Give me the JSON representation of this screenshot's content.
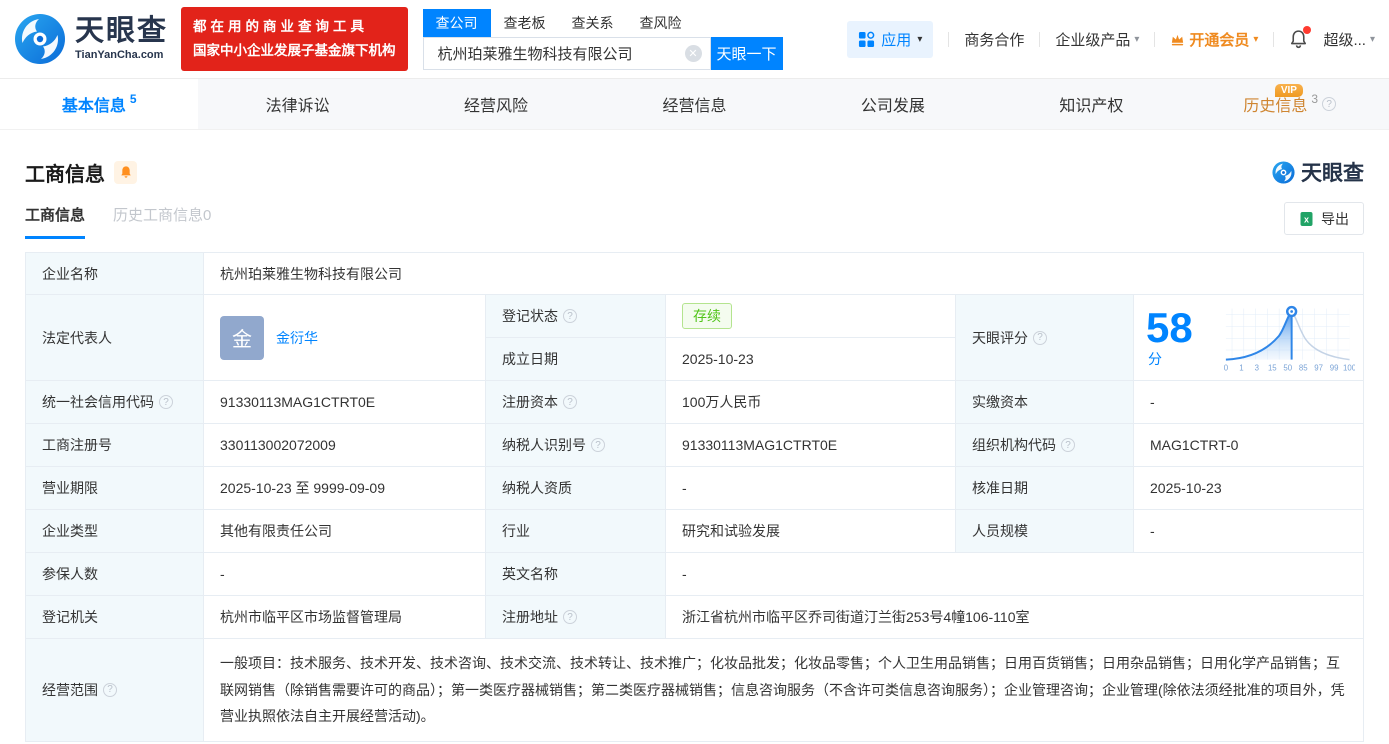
{
  "brand": {
    "name": "天眼查",
    "domain": "TianYanCha.com",
    "banner_line1": "都在用的商业查询工具",
    "banner_line2": "国家中小企业发展子基金旗下机构"
  },
  "search": {
    "tabs": [
      "查公司",
      "查老板",
      "查关系",
      "查风险"
    ],
    "value": "杭州珀莱雅生物科技有限公司",
    "button": "天眼一下"
  },
  "nav": {
    "apps": "应用",
    "biz_coop": "商务合作",
    "enterprise": "企业级产品",
    "vip": "开通会员",
    "super": "超级..."
  },
  "tabs": [
    {
      "label": "基本信息",
      "count": "5"
    },
    {
      "label": "法律诉讼",
      "count": ""
    },
    {
      "label": "经营风险",
      "count": ""
    },
    {
      "label": "经营信息",
      "count": ""
    },
    {
      "label": "公司发展",
      "count": ""
    },
    {
      "label": "知识产权",
      "count": ""
    },
    {
      "label": "历史信息",
      "count": "3",
      "badge": "VIP"
    }
  ],
  "section": {
    "title": "工商信息",
    "watermark": "天眼查",
    "subtab_active": "工商信息",
    "subtab_history": "历史工商信息0",
    "export": "导出"
  },
  "fields": {
    "company_name": {
      "label": "企业名称",
      "value": "杭州珀莱雅生物科技有限公司"
    },
    "legal_rep": {
      "label": "法定代表人",
      "avatar": "金",
      "name": "金衍华"
    },
    "reg_status": {
      "label": "登记状态",
      "value": "存续"
    },
    "establish_date": {
      "label": "成立日期",
      "value": "2025-10-23"
    },
    "score": {
      "label": "天眼评分",
      "value": "58",
      "unit": "分",
      "axis": [
        "0",
        "1",
        "3",
        "15",
        "50",
        "85",
        "97",
        "99",
        "100"
      ]
    },
    "credit_code": {
      "label": "统一社会信用代码",
      "value": "91330113MAG1CTRT0E"
    },
    "reg_capital": {
      "label": "注册资本",
      "value": "100万人民币"
    },
    "paid_capital": {
      "label": "实缴资本",
      "value": "-"
    },
    "reg_number": {
      "label": "工商注册号",
      "value": "330113002072009"
    },
    "taxpayer_id": {
      "label": "纳税人识别号",
      "value": "91330113MAG1CTRT0E"
    },
    "org_code": {
      "label": "组织机构代码",
      "value": "MAG1CTRT-0"
    },
    "business_term": {
      "label": "营业期限",
      "value": "2025-10-23 至 9999-09-09"
    },
    "taxpayer_quality": {
      "label": "纳税人资质",
      "value": "-"
    },
    "approval_date": {
      "label": "核准日期",
      "value": "2025-10-23"
    },
    "company_type": {
      "label": "企业类型",
      "value": "其他有限责任公司"
    },
    "industry": {
      "label": "行业",
      "value": "研究和试验发展"
    },
    "staff_size": {
      "label": "人员规模",
      "value": "-"
    },
    "insured_count": {
      "label": "参保人数",
      "value": "-"
    },
    "english_name": {
      "label": "英文名称",
      "value": "-"
    },
    "reg_authority": {
      "label": "登记机关",
      "value": "杭州市临平区市场监督管理局"
    },
    "reg_address": {
      "label": "注册地址",
      "value": "浙江省杭州市临平区乔司街道汀兰街253号4幢106-110室"
    },
    "business_scope": {
      "label": "经营范围",
      "value": "一般项目：技术服务、技术开发、技术咨询、技术交流、技术转让、技术推广；化妆品批发；化妆品零售；个人卫生用品销售；日用百货销售；日用杂品销售；日用化学产品销售；互联网销售（除销售需要许可的商品）；第一类医疗器械销售；第二类医疗器械销售；信息咨询服务（不含许可类信息咨询服务）；企业管理咨询；企业管理(除依法须经批准的项目外，凭营业执照依法自主开展经营活动)。"
    }
  },
  "chart_data": {
    "type": "area",
    "title": "天眼评分分布曲线",
    "score": 58,
    "x_ticks": [
      "0",
      "1",
      "3",
      "15",
      "50",
      "85",
      "97",
      "99",
      "100"
    ],
    "marker_position": "just right of the 50 tick at the curve peak",
    "colors": {
      "curve_left": "#2f86e8",
      "curve_right": "#c4d3e6",
      "accent": "#0084ff"
    }
  },
  "colors": {
    "primary_blue": "#0084ff",
    "banner_red": "#e2231a",
    "orange": "#ef8a1f",
    "status_green": "#52c41a",
    "label_bg": "#f2f9fc",
    "table_border": "#e7edf3"
  }
}
